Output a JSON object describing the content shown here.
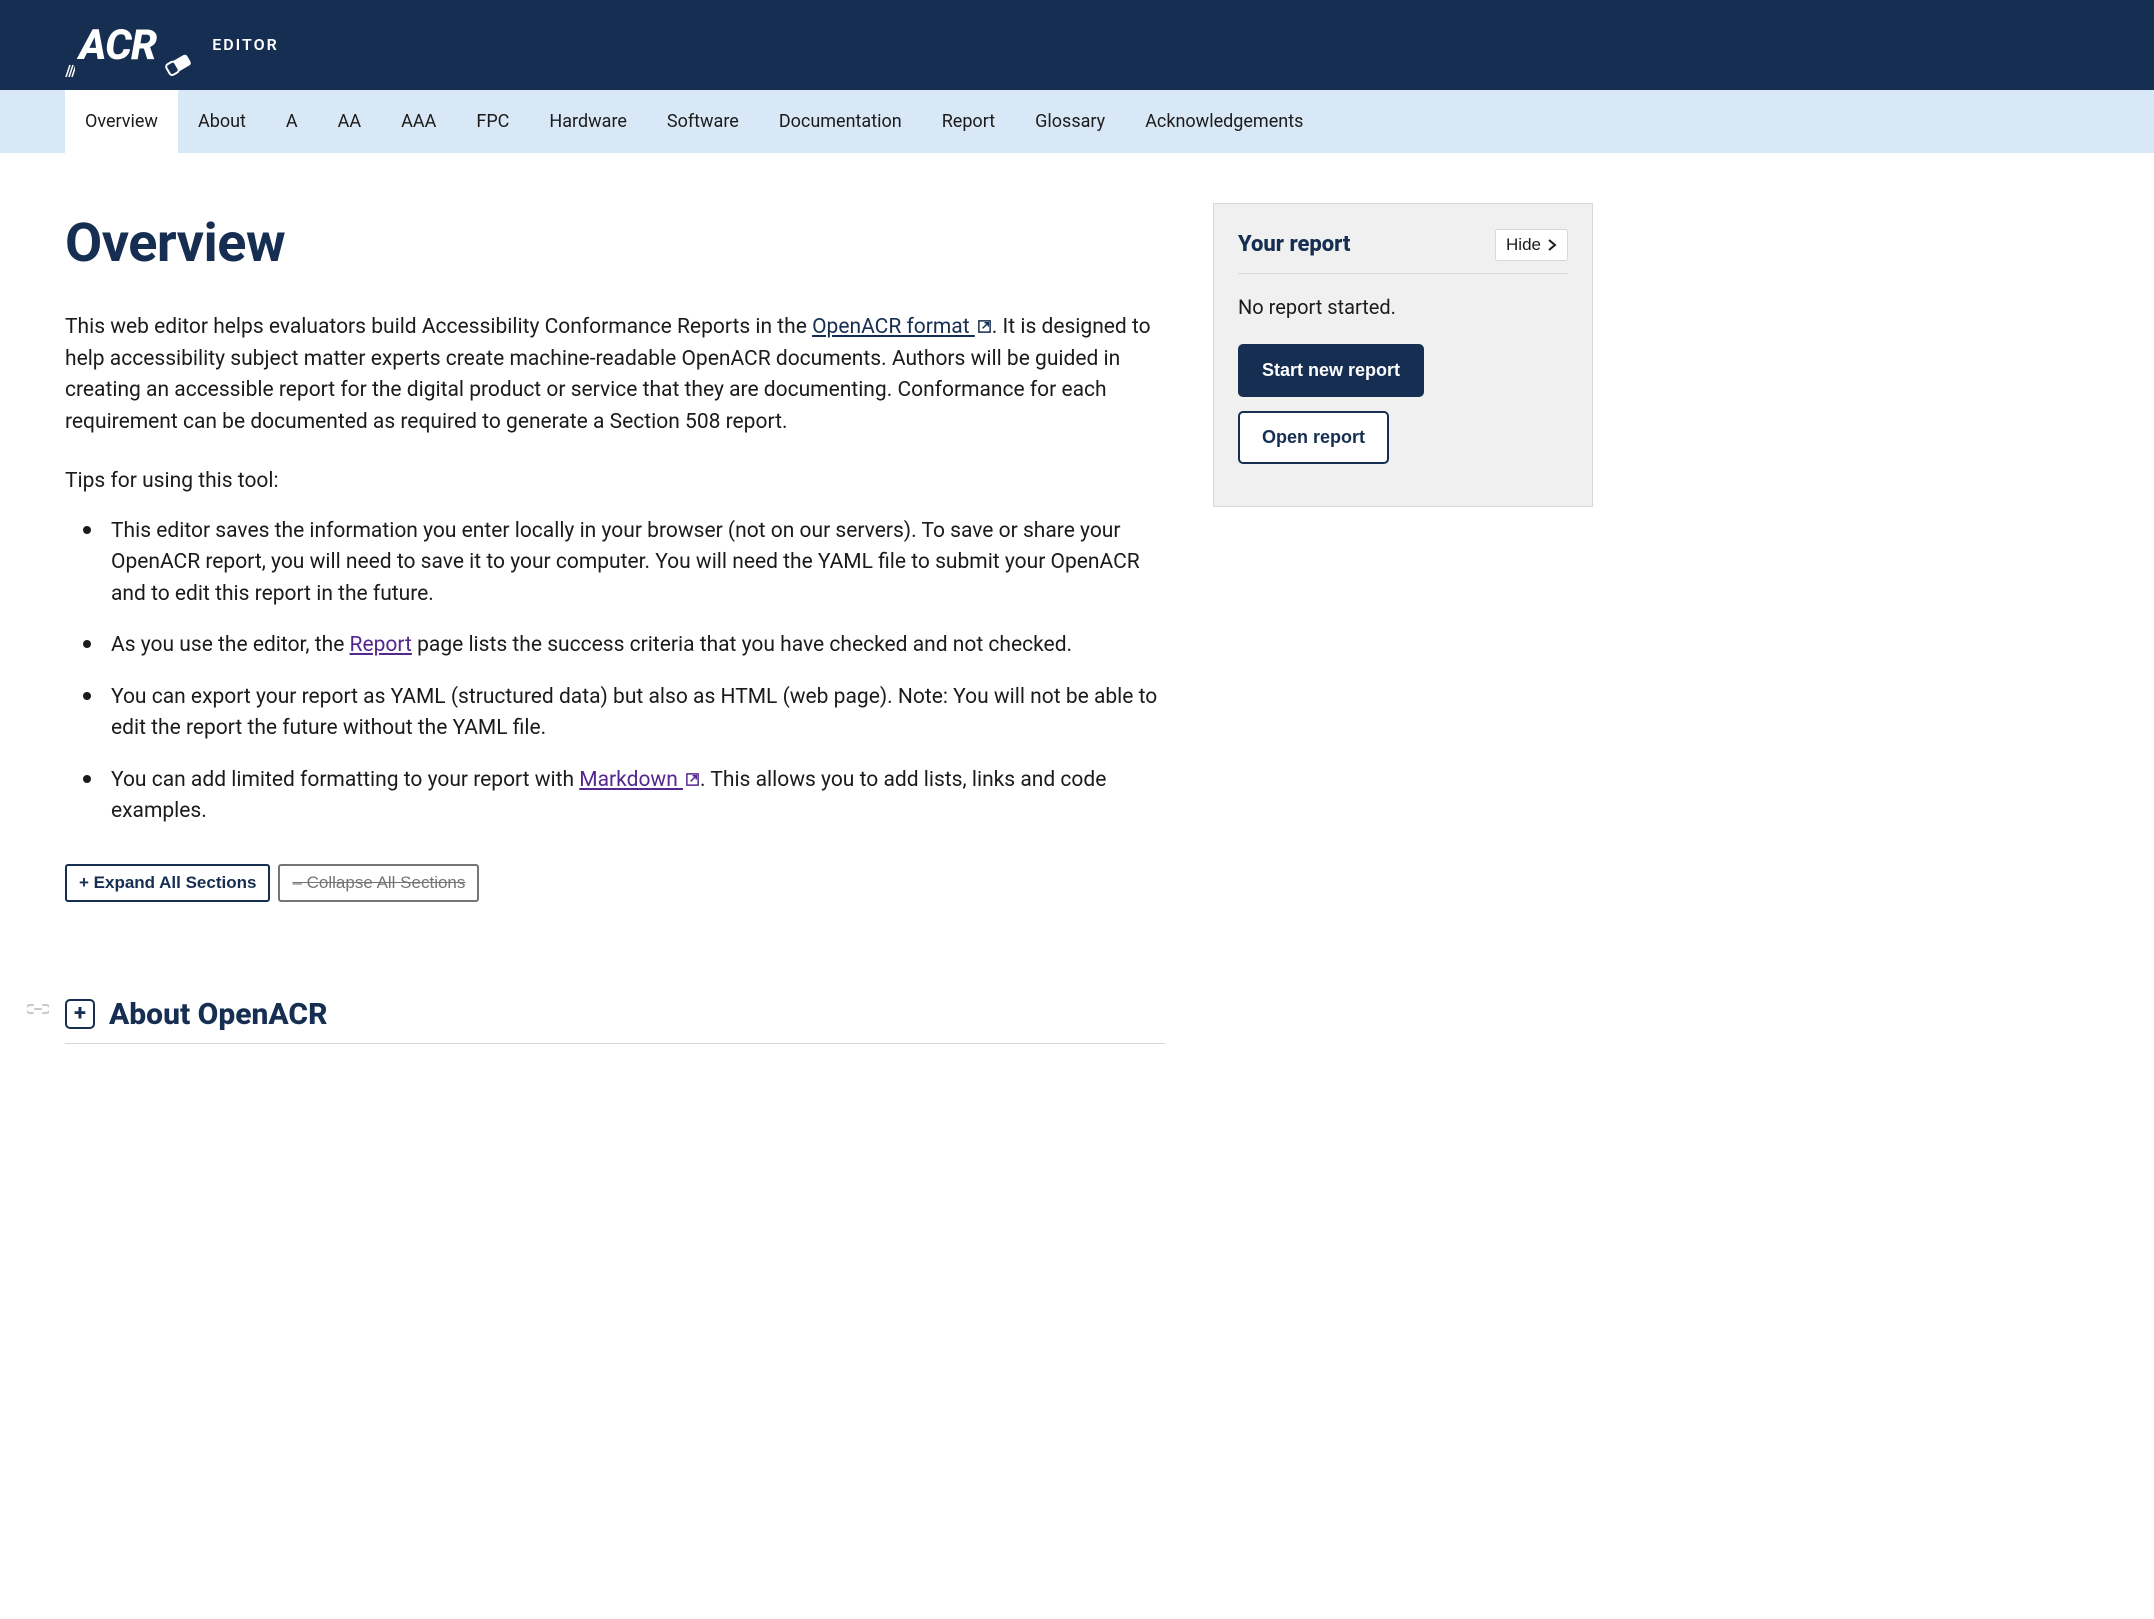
{
  "header": {
    "logo_text": "ACR",
    "editor_label": "EDITOR"
  },
  "nav": {
    "items": [
      {
        "label": "Overview",
        "active": true
      },
      {
        "label": "About",
        "active": false
      },
      {
        "label": "A",
        "active": false
      },
      {
        "label": "AA",
        "active": false
      },
      {
        "label": "AAA",
        "active": false
      },
      {
        "label": "FPC",
        "active": false
      },
      {
        "label": "Hardware",
        "active": false
      },
      {
        "label": "Software",
        "active": false
      },
      {
        "label": "Documentation",
        "active": false
      },
      {
        "label": "Report",
        "active": false
      },
      {
        "label": "Glossary",
        "active": false
      },
      {
        "label": "Acknowledgements",
        "active": false
      }
    ]
  },
  "page": {
    "title": "Overview",
    "intro_pre": "This web editor helps evaluators build Accessibility Conformance Reports in the ",
    "intro_link1": "OpenACR format ",
    "intro_post": ". It is designed to help accessibility subject matter experts create machine-readable OpenACR documents. Authors will be guided in creating an accessible report for the digital product or service that they are documenting. Conformance for each requirement can be documented as required to generate a Section 508 report.",
    "tips_lead": "Tips for using this tool:",
    "tips": [
      {
        "pre": "This editor saves the information you enter locally in your browser (not on our servers). To save or share your OpenACR report, you will need to save it to your computer. You will need the YAML file to submit your OpenACR and to edit this report in the future.",
        "link": "",
        "post": ""
      },
      {
        "pre": "As you use the editor, the ",
        "link": "Report",
        "post": " page lists the success criteria that you have checked and not checked."
      },
      {
        "pre": "You can export your report as YAML (structured data) but also as HTML (web page). Note: You will not be able to edit the report the future without the YAML file.",
        "link": "",
        "post": ""
      },
      {
        "pre": "You can add limited formatting to your report with ",
        "link": "Markdown ",
        "post": ". This allows you to add lists, links and code examples."
      }
    ],
    "expand_btn": "+ Expand All Sections",
    "collapse_btn": "– Collapse All Sections",
    "accordion1_title": "About OpenACR"
  },
  "sidebar": {
    "title": "Your report",
    "hide_label": "Hide",
    "status": "No report started.",
    "start_btn": "Start new report",
    "open_btn": "Open report"
  }
}
